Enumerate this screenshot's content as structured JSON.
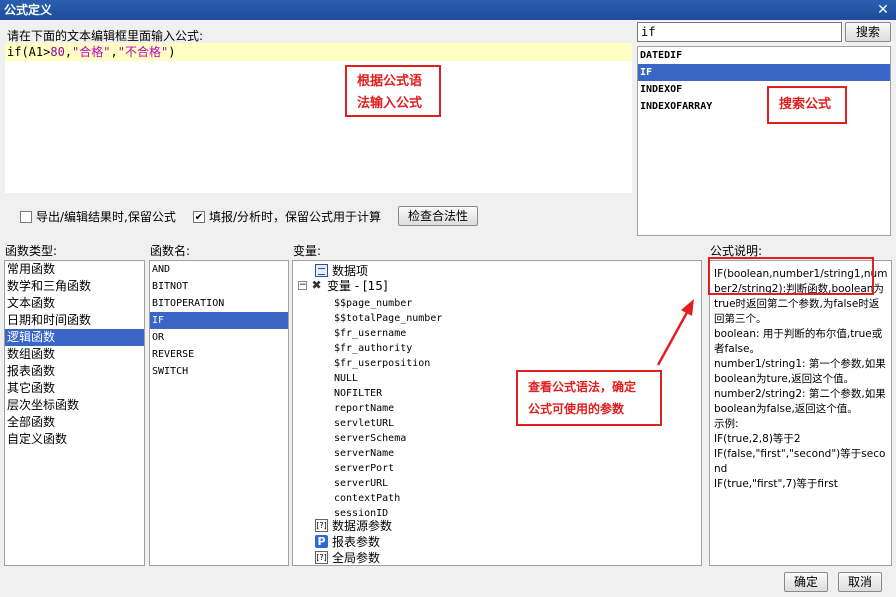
{
  "window": {
    "title": "公式定义",
    "close_glyph": "✕"
  },
  "editor": {
    "prompt": "请在下面的文本编辑框里面输入公式:",
    "code_prefix": "if(A1>",
    "code_num": "80",
    "code_sep1": ",",
    "code_str1": "\"合格\"",
    "code_sep2": ",",
    "code_str2": "\"不合格\"",
    "code_suffix": ")"
  },
  "annotations": {
    "input_hint_line1": "根据公式语",
    "input_hint_line2": "法输入公式",
    "search_hint": "搜索公式",
    "syntax_hint_line1": "查看公式语法，确定",
    "syntax_hint_line2": "公式可使用的参数"
  },
  "search": {
    "value": "if",
    "button": "搜索",
    "results": [
      "DATEDIF",
      "IF",
      "INDEXOF",
      "INDEXOFARRAY"
    ],
    "selected_index": 1
  },
  "options": {
    "keep_on_export": {
      "label": "导出/编辑结果时,保留公式",
      "checked": false
    },
    "keep_on_fill": {
      "label": "填报/分析时，保留公式用于计算",
      "checked": true
    },
    "check_button": "检查合法性"
  },
  "function_types": {
    "header": "函数类型:",
    "items": [
      "常用函数",
      "数学和三角函数",
      "文本函数",
      "日期和时间函数",
      "逻辑函数",
      "数组函数",
      "报表函数",
      "其它函数",
      "层次坐标函数",
      "全部函数",
      "自定义函数"
    ],
    "selected_index": 4
  },
  "function_names": {
    "header": "函数名:",
    "items": [
      "AND",
      "BITNOT",
      "BITOPERATION",
      "IF",
      "OR",
      "REVERSE",
      "SWITCH"
    ],
    "selected_index": 3
  },
  "variables": {
    "header": "变量:",
    "data_item": "数据项",
    "var_group": "变量 - [15]",
    "vars": [
      "$$page_number",
      "$$totalPage_number",
      "$fr_username",
      "$fr_authority",
      "$fr_userposition",
      "NULL",
      "NOFILTER",
      "reportName",
      "servletURL",
      "serverSchema",
      "serverName",
      "serverPort",
      "serverURL",
      "contextPath",
      "sessionID"
    ],
    "datasource_params": "数据源参数",
    "report_params": "报表参数",
    "global_params": "全局参数"
  },
  "description": {
    "header": "公式说明:",
    "lines": [
      "IF(boolean,number1/string1,number2/string2):判断函数,boolean为true时返回第二个参数,为false时返回第三个。",
      "boolean: 用于判断的布尔值,true或者false。",
      "number1/string1: 第一个参数,如果boolean为ture,返回这个值。",
      "number2/string2: 第二个参数,如果boolean为false,返回这个值。",
      "示例:",
      "IF(true,2,8)等于2",
      "IF(false,\"first\",\"second\")等于second",
      "IF(true,\"first\",7)等于first"
    ]
  },
  "buttons": {
    "ok": "确定",
    "cancel": "取消"
  },
  "colors": {
    "title_bar": "#1d4c9a",
    "selection": "#3a66c8",
    "callout": "#e02020",
    "editor_line": "#ffffc4"
  }
}
